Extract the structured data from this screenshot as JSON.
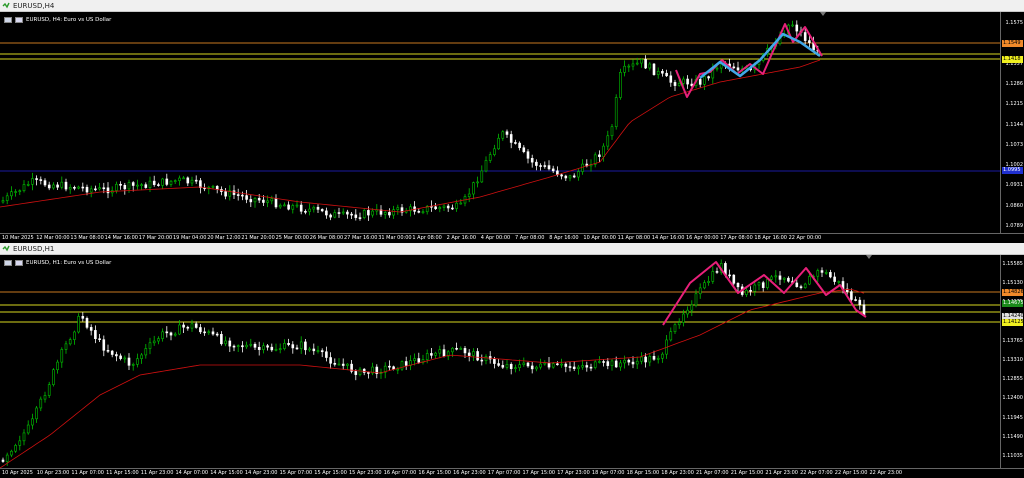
{
  "windows": [
    {
      "title": "EURUSD,H4",
      "header": "EURUSD, H4: Euro vs US Dollar",
      "price_ticks": [
        "1.1575",
        "1.1495",
        "1.1357",
        "1.1286",
        "1.1215",
        "1.1144",
        "1.1073",
        "1.1002",
        "1.0931",
        "1.0860",
        "1.0789"
      ],
      "price_tags": [
        {
          "text": "1.1549",
          "bg": "#f08a2a",
          "fg": "#000"
        },
        {
          "text": "1.1418",
          "bg": "#f0f020",
          "fg": "#000"
        },
        {
          "text": "1.0995",
          "bg": "#2030d0",
          "fg": "#fff"
        }
      ],
      "time_ticks": [
        "10 Mar 2025",
        "12 Mar 00:00",
        "13 Mar 08:00",
        "14 Mar 16:00",
        "17 Mar 20:00",
        "19 Mar 04:00",
        "20 Mar 12:00",
        "21 Mar 20:00",
        "25 Mar 00:00",
        "26 Mar 08:00",
        "27 Mar 16:00",
        "31 Mar 00:00",
        "1 Apr 08:00",
        "2 Apr 16:00",
        "4 Apr 00:00",
        "7 Apr 08:00",
        "8 Apr 16:00",
        "10 Apr 00:00",
        "11 Apr 08:00",
        "14 Apr 16:00",
        "16 Apr 00:00",
        "17 Apr 08:00",
        "18 Apr 16:00",
        "22 Apr 00:00"
      ]
    },
    {
      "title": "EURUSD,H1",
      "header": "EURUSD, H1: Euro vs US Dollar",
      "price_ticks": [
        "1.15585",
        "1.15130",
        "1.14675",
        "1.14220",
        "1.13765",
        "1.13310",
        "1.12855",
        "1.12400",
        "1.11945",
        "1.11490",
        "1.11035"
      ],
      "price_tags": [
        {
          "text": "1.14826",
          "bg": "#f08a2a",
          "fg": "#000"
        },
        {
          "text": "1.14675",
          "bg": "#1a8a1a",
          "fg": "#fff"
        },
        {
          "text": "1.14240",
          "bg": "#e0e0e0",
          "fg": "#000"
        },
        {
          "text": "1.14125",
          "bg": "#f0f020",
          "fg": "#000"
        }
      ],
      "time_ticks": [
        "10 Apr 2025",
        "10 Apr 23:00",
        "11 Apr 07:00",
        "11 Apr 15:00",
        "11 Apr 23:00",
        "14 Apr 07:00",
        "14 Apr 15:00",
        "14 Apr 23:00",
        "15 Apr 07:00",
        "15 Apr 15:00",
        "15 Apr 23:00",
        "16 Apr 07:00",
        "16 Apr 15:00",
        "16 Apr 23:00",
        "17 Apr 07:00",
        "17 Apr 15:00",
        "17 Apr 23:00",
        "18 Apr 07:00",
        "18 Apr 15:00",
        "18 Apr 23:00",
        "21 Apr 07:00",
        "21 Apr 15:00",
        "21 Apr 23:00",
        "22 Apr 07:00",
        "22 Apr 15:00",
        "22 Apr 23:00"
      ]
    }
  ],
  "colors": {
    "bull_candle": "#00c000",
    "bear_candle": "#ffffff",
    "moving_average": "#d01010",
    "resistance_line": "#c87820",
    "support_line": "#d8d820",
    "blue_line": "#1a1aa0",
    "pattern_pink": "#e8207a",
    "pattern_blue": "#40a8e8"
  }
}
